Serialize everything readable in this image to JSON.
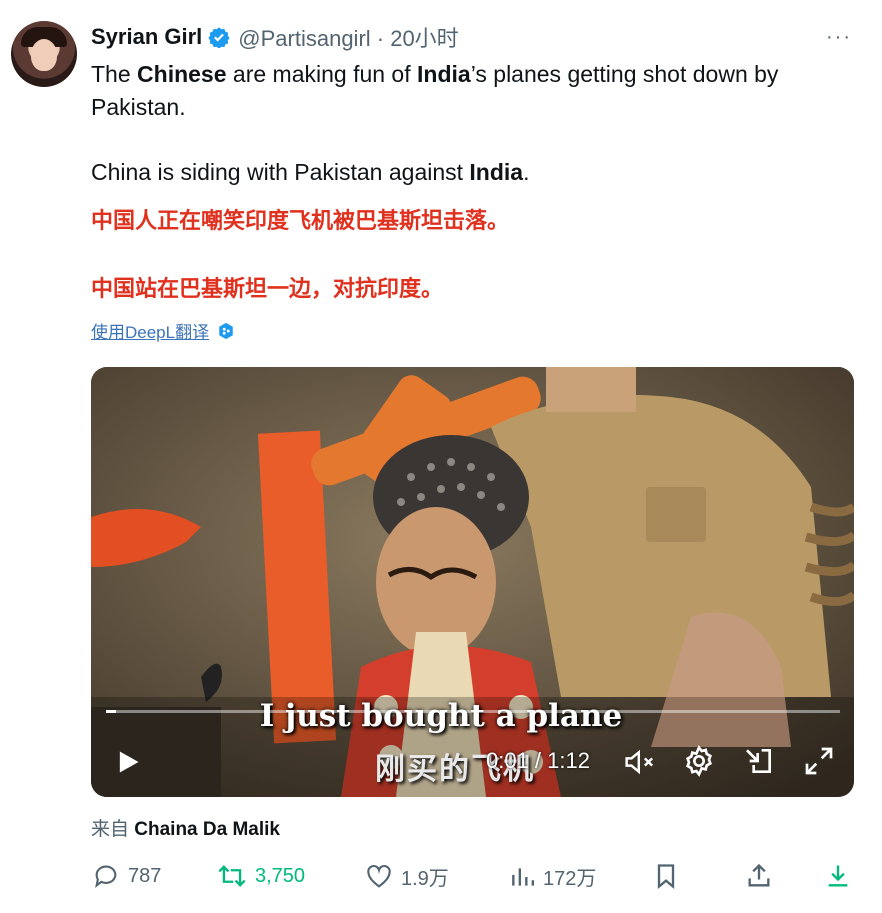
{
  "tweet": {
    "author_name": "Syrian Girl",
    "handle_time": "@Partisangirl · 20小时",
    "more_label": "···",
    "paragraph1": {
      "p1": "The ",
      "b1": "Chinese",
      "p2": " are making fun of ",
      "b2": "India",
      "p3": "’s planes getting shot down by Pakistan."
    },
    "paragraph2": {
      "p1": "China is siding with Pakistan against ",
      "b1": "India",
      "p2": "."
    },
    "chinese_line1": "中国人正在嘲笑印度飞机被巴基斯坦击落。",
    "chinese_line2": "中国站在巴基斯坦一边，对抗印度。",
    "translate_label": "使用DeepL翻译",
    "source_prefix": "来自 ",
    "source_name": "Chaina Da Malik"
  },
  "video": {
    "subtitle_en": "I just bought a plane",
    "subtitle_cn": "刚买的飞机",
    "time": "0:01 / 1:12",
    "progress": 0.014
  },
  "actions": {
    "replies": "787",
    "retweets": "3,750",
    "likes": "1.9万",
    "views": "172万"
  },
  "icons": [
    "verified-badge-icon",
    "play-icon",
    "mute-icon",
    "settings-icon",
    "pip-icon",
    "fullscreen-icon",
    "reply-icon",
    "retweet-icon",
    "like-icon",
    "views-icon",
    "bookmark-icon",
    "share-icon",
    "download-icon",
    "deepl-icon"
  ],
  "colors": {
    "accent": "#1d9bf0",
    "chinese_text": "#e0301e",
    "retweet": "#00ba7c",
    "muted": "#536471"
  }
}
